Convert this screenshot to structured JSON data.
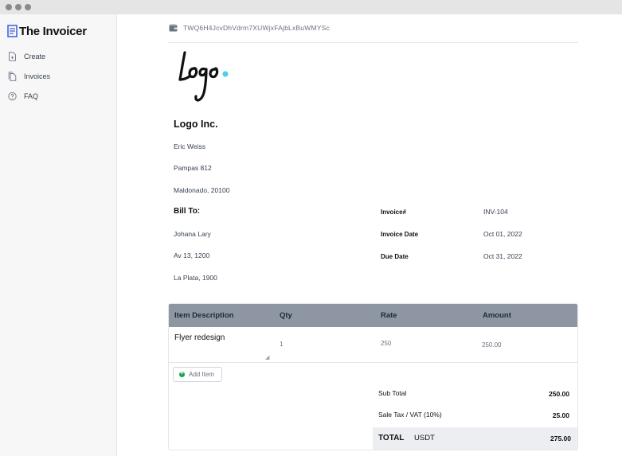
{
  "window": {
    "controls": [
      "close",
      "minimize",
      "zoom"
    ]
  },
  "sidebar": {
    "brand": "The Invoicer",
    "items": [
      {
        "label": "Create",
        "icon": "file-plus-icon"
      },
      {
        "label": "Invoices",
        "icon": "files-icon"
      },
      {
        "label": "FAQ",
        "icon": "question-icon"
      }
    ]
  },
  "wallet": {
    "address": "TWQ6H4JcvDhVdrm7XUWjxFAjbLxBuWMYSc",
    "icon": "wallet-icon"
  },
  "invoice": {
    "logo": {
      "text": "Logo",
      "accent_color": "#4fd1e8"
    },
    "company": {
      "name": "Logo Inc.",
      "contact": "Eric Weiss",
      "address1": "Pampas 812",
      "address2": "Maldonado, 20100"
    },
    "bill_to": {
      "heading": "Bill To:",
      "name": "Johana Lary",
      "address1": "Av 13, 1200",
      "address2": "La Plata, 1900"
    },
    "meta": [
      {
        "label": "Invoice#",
        "value": "INV-104"
      },
      {
        "label": "Invoice Date",
        "value": "Oct 01, 2022"
      },
      {
        "label": "Due Date",
        "value": "Oct 31, 2022"
      }
    ],
    "table": {
      "headers": [
        "Item Description",
        "Qty",
        "Rate",
        "Amount"
      ],
      "rows": [
        {
          "description": "Flyer redesign",
          "qty": "1",
          "rate": "250",
          "amount": "250.00"
        }
      ],
      "add_item_label": "Add Item"
    },
    "summary": {
      "subtotal_label": "Sub Total",
      "subtotal_value": "250.00",
      "tax_label": "Sale Tax / VAT (10%)",
      "tax_value": "25.00",
      "total_label": "TOTAL",
      "currency": "USDT",
      "total_value": "275.00"
    }
  },
  "colors": {
    "table_header": "#8d96a2",
    "brand_icon": "#3b5bdb",
    "add_icon": "#16a34a",
    "total_bg": "#eceef1"
  }
}
